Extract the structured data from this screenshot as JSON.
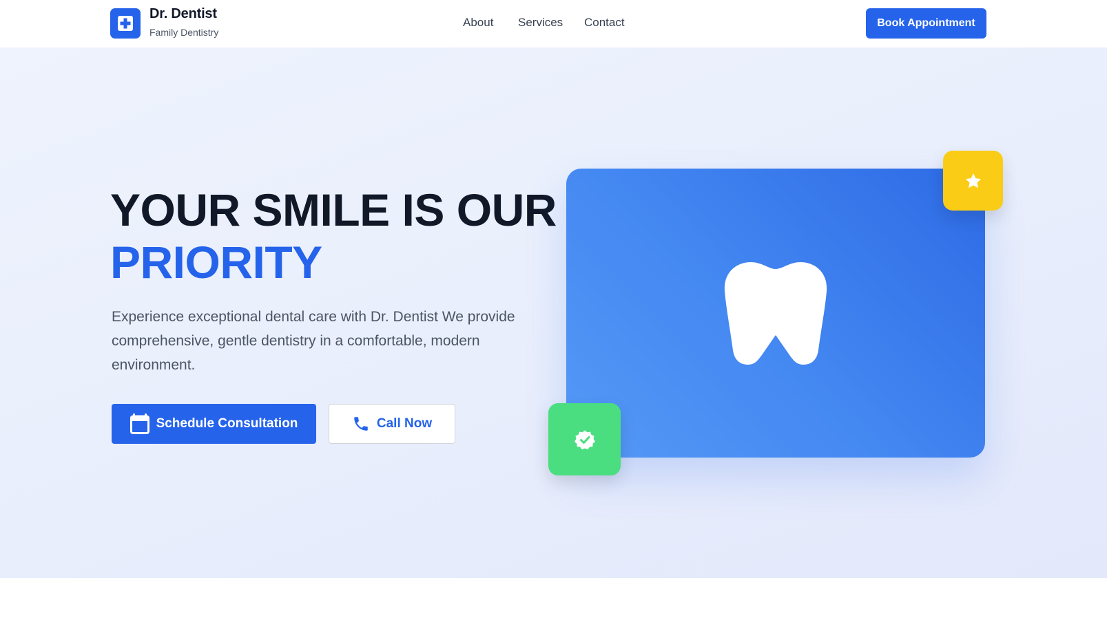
{
  "header": {
    "brand_name": "Dr. Dentist",
    "brand_tagline": "Family Dentistry",
    "logo_icon": "medical-cross-icon",
    "nav": [
      {
        "label": "About"
      },
      {
        "label": "Services"
      },
      {
        "label": "Contact"
      }
    ],
    "cta_label": "Book Appointment"
  },
  "hero": {
    "headline_line1": "YOUR SMILE IS OUR",
    "headline_line2": "PRIORITY",
    "lede": "Experience exceptional dental care with Dr. Dentist We provide comprehensive, gentle dentistry in a comfortable, modern environment.",
    "primary_button": {
      "label": "Schedule Consultation",
      "icon": "calendar-icon"
    },
    "secondary_button": {
      "label": "Call Now",
      "icon": "phone-icon"
    }
  },
  "illustration": {
    "main_icon": "tooth-icon",
    "top_badge_icon": "star-icon",
    "bottom_badge_icon": "verified-check-icon"
  },
  "colors": {
    "primary": "#2563eb",
    "headline": "#111827",
    "star_badge": "#facc15",
    "check_badge": "#4ade80",
    "hero_background": "#e8eefc"
  }
}
